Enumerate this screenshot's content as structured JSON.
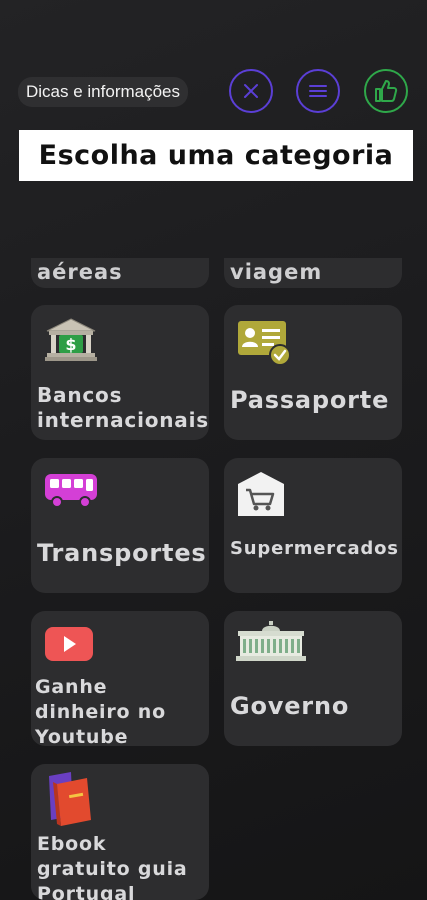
{
  "header": {
    "tips_label": "Dicas e informações",
    "close_icon": "close-icon",
    "menu_icon": "menu-icon",
    "like_icon": "thumbs-up-icon",
    "accent_color": "#5b3fd6",
    "like_color": "#2fa84a"
  },
  "title": "Escolha uma categoria",
  "categories": [
    {
      "label": "aéreas",
      "icon": "partial"
    },
    {
      "label": "viagem",
      "icon": "partial"
    },
    {
      "label": "Bancos internacionais",
      "icon": "bank-icon"
    },
    {
      "label": "Passaporte",
      "icon": "id-card-icon"
    },
    {
      "label": "Transportes",
      "icon": "bus-icon"
    },
    {
      "label": "Supermercados",
      "icon": "shopping-cart-icon"
    },
    {
      "label": "Ganhe dinheiro no Youtube",
      "icon": "youtube-icon"
    },
    {
      "label": "Governo",
      "icon": "government-building-icon"
    },
    {
      "label": "Ebook gratuito guia Portugal",
      "icon": "book-icon"
    }
  ]
}
